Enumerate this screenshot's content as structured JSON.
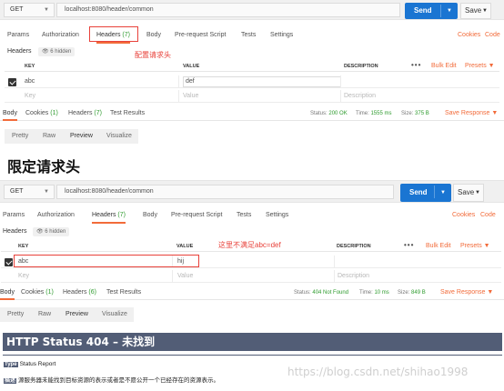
{
  "top": {
    "method": "GET",
    "url": "localhost:8080/header/common",
    "send": "Send",
    "save": "Save",
    "tabs": {
      "params": "Params",
      "authorization": "Authorization",
      "headers": "Headers",
      "headers_count": "(7)",
      "body": "Body",
      "prerequest": "Pre-request Script",
      "tests": "Tests",
      "settings": "Settings",
      "cookies": "Cookies",
      "code": "Code"
    },
    "headers_label": "Headers",
    "hidden": "6 hidden",
    "annotation": "配置请求头",
    "columns": {
      "key": "KEY",
      "value": "VALUE",
      "description": "DESCRIPTION",
      "bulk": "Bulk Edit",
      "presets": "Presets"
    },
    "row": {
      "key": "abc",
      "value": "def"
    },
    "placeholders": {
      "key": "Key",
      "value": "Value",
      "description": "Description"
    },
    "response": {
      "body": "Body",
      "cookies": "Cookies",
      "cookies_count": "(1)",
      "headers": "Headers",
      "headers_count": "(7)",
      "test_results": "Test Results",
      "status_label": "Status:",
      "status_value": "200 OK",
      "time_label": "Time:",
      "time_value": "1555 ms",
      "size_label": "Size:",
      "size_value": "375 B",
      "save_response": "Save Response"
    },
    "views": [
      "Pretty",
      "Raw",
      "Preview",
      "Visualize"
    ]
  },
  "heading": "限定请求头",
  "bottom": {
    "method": "GET",
    "url": "localhost:8080/header/common",
    "send": "Send",
    "save": "Save",
    "tabs": {
      "params": "Params",
      "authorization": "Authorization",
      "headers": "Headers",
      "headers_count": "(7)",
      "body": "Body",
      "prerequest": "Pre-request Script",
      "tests": "Tests",
      "settings": "Settings",
      "cookies": "Cookies",
      "code": "Code"
    },
    "headers_label": "Headers",
    "hidden": "6 hidden",
    "annotation": "这里不满足abc=def",
    "columns": {
      "key": "KEY",
      "value": "VALUE",
      "description": "DESCRIPTION",
      "bulk": "Bulk Edit",
      "presets": "Presets"
    },
    "row": {
      "key": "abc",
      "value": "hij"
    },
    "placeholders": {
      "key": "Key",
      "value": "Value",
      "description": "Description"
    },
    "response": {
      "body": "Body",
      "cookies": "Cookies",
      "cookies_count": "(1)",
      "headers": "Headers",
      "headers_count": "(6)",
      "test_results": "Test Results",
      "status_label": "Status:",
      "status_value": "404 Not Found",
      "time_label": "Time:",
      "time_value": "10 ms",
      "size_label": "Size:",
      "size_value": "849 B",
      "save_response": "Save Response"
    },
    "views": [
      "Pretty",
      "Raw",
      "Preview",
      "Visualize"
    ]
  },
  "error_page": {
    "title": "HTTP Status 404 – 未找到",
    "type_label": "Type",
    "type_value": "Status Report",
    "desc_label": "描述",
    "desc_value": "源服务器未能找到目标资源的表示或者是不愿公开一个已经存在的资源表示。"
  },
  "watermark": "https://blog.csdn.net/shihao1998",
  "colors": {
    "accent": "#f26b3a",
    "send": "#1a75d2",
    "annotation": "#e8413a",
    "tomcat": "#525d76"
  }
}
